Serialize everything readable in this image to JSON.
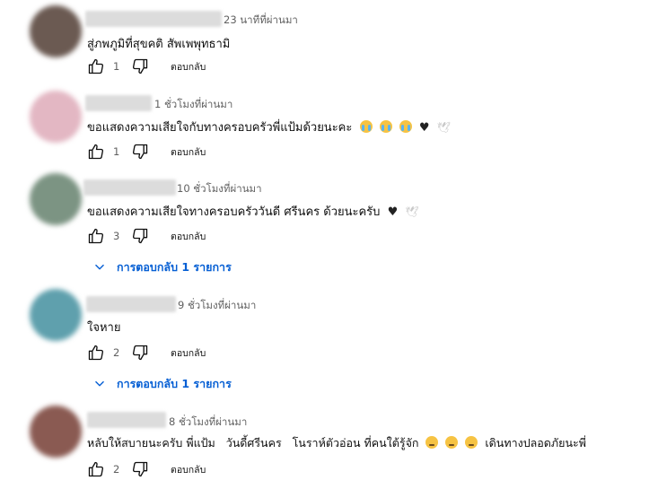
{
  "comments": [
    {
      "time": "23 นาทีที่ผ่านมา",
      "text": "สู่ภพภูมิที่สุขคติ สัพเพพุทธามิ",
      "likes": "1",
      "reply_label": "ตอบกลับ",
      "avatar_color": "#6b5a52",
      "emojis": []
    },
    {
      "time": "1 ชั่วโมงที่ผ่านมา",
      "text": "ขอแสดงความเสียใจกับทางครอบครัวพี่แป้มด้วยนะคะ",
      "likes": "1",
      "reply_label": "ตอบกลับ",
      "avatar_color": "#e3b7c3",
      "emojis": [
        "loudly-crying-face",
        "loudly-crying-face",
        "loudly-crying-face",
        "black-heart",
        "dove"
      ]
    },
    {
      "time": "10 ชั่วโมงที่ผ่านมา",
      "text": "ขอแสดงความเสียใจทางครอบครัววันดี ศรีนคร ด้วยนะครับ",
      "likes": "3",
      "reply_label": "ตอบกลับ",
      "avatar_color": "#7c9483",
      "emojis": [
        "black-heart",
        "dove"
      ],
      "replies_label": "การตอบกลับ 1 รายการ"
    },
    {
      "time": "9 ชั่วโมงที่ผ่านมา",
      "text": "ใจหาย",
      "likes": "2",
      "reply_label": "ตอบกลับ",
      "avatar_color": "#5fa0ad",
      "emojis": [],
      "replies_label": "การตอบกลับ 1 รายการ"
    },
    {
      "time": "8 ชั่วโมงที่ผ่านมา",
      "text_part1": "หลับให้สบายนะครับ พี่แป้ม   วันดี้ศรีนคร   โนราห์ตัวอ่อน ที่คนใต้รู้จัก",
      "text_part2": "เดินทางปลอดภัยนะพี่",
      "likes": "2",
      "reply_label": "ตอบกลับ",
      "avatar_color": "#8a5a52",
      "emojis": [
        "sad-face",
        "sad-face",
        "sad-face"
      ]
    }
  ],
  "colors": {
    "link_blue": "#065fd4",
    "meta_gray": "#606060",
    "text": "#0f0f0f"
  },
  "icons": [
    "thumb-up-icon",
    "thumb-down-icon",
    "chevron-down-icon"
  ]
}
